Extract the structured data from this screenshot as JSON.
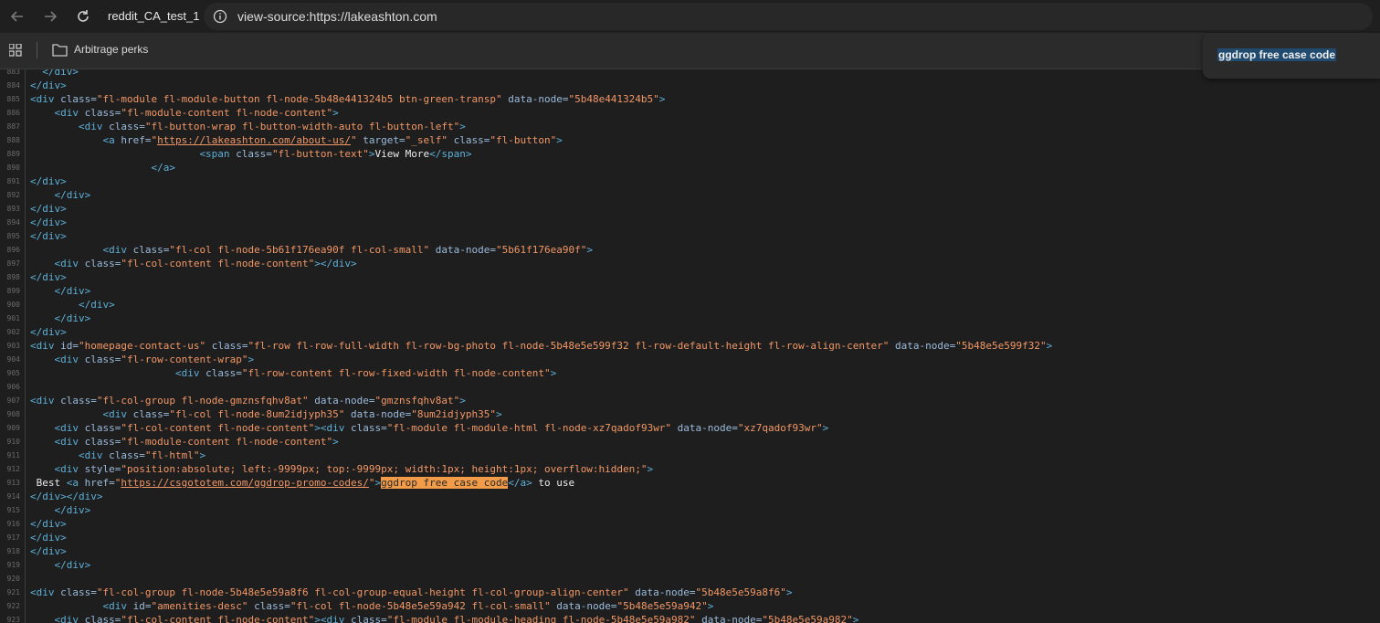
{
  "tab": {
    "title": "reddit_CA_test_1"
  },
  "omnibox": {
    "url": "view-source:https://lakeashton.com"
  },
  "bookmarks": [
    {
      "label": "Arbitrage perks"
    }
  ],
  "find": {
    "query": "ggdrop free case code"
  },
  "colors": {
    "tag": "#5db0d7",
    "attr": "#9bbbdc",
    "value": "#f29766",
    "highlight": "#f29b48",
    "background": "#1e1e1e"
  },
  "source_lines": [
    {
      "n": "883",
      "ind": 2,
      "seg": [
        [
          "tag",
          "</div>"
        ]
      ]
    },
    {
      "n": "884",
      "ind": 0,
      "seg": [
        [
          "tag",
          "</div>"
        ]
      ]
    },
    {
      "n": "885",
      "ind": 0,
      "seg": [
        [
          "tag",
          "<div "
        ],
        [
          "attr",
          "class="
        ],
        [
          "val",
          "\"fl-module fl-module-button fl-node-5b48e441324b5 btn-green-transp\""
        ],
        [
          "attr",
          " data-node="
        ],
        [
          "val",
          "\"5b48e441324b5\""
        ],
        [
          "tag",
          ">"
        ]
      ]
    },
    {
      "n": "886",
      "ind": 4,
      "seg": [
        [
          "tag",
          "<div "
        ],
        [
          "attr",
          "class="
        ],
        [
          "val",
          "\"fl-module-content fl-node-content\""
        ],
        [
          "tag",
          ">"
        ]
      ]
    },
    {
      "n": "887",
      "ind": 8,
      "seg": [
        [
          "tag",
          "<div "
        ],
        [
          "attr",
          "class="
        ],
        [
          "val",
          "\"fl-button-wrap fl-button-width-auto fl-button-left\""
        ],
        [
          "tag",
          ">"
        ]
      ]
    },
    {
      "n": "888",
      "ind": 12,
      "seg": [
        [
          "tag",
          "<a "
        ],
        [
          "attr",
          "href="
        ],
        [
          "val",
          "\""
        ],
        [
          "link",
          "https://lakeashton.com/about-us/"
        ],
        [
          "val",
          "\""
        ],
        [
          "attr",
          " target="
        ],
        [
          "val",
          "\"_self\""
        ],
        [
          "attr",
          " class="
        ],
        [
          "val",
          "\"fl-button\""
        ],
        [
          "tag",
          ">"
        ]
      ]
    },
    {
      "n": "889",
      "ind": 28,
      "seg": [
        [
          "tag",
          "<span "
        ],
        [
          "attr",
          "class="
        ],
        [
          "val",
          "\"fl-button-text\""
        ],
        [
          "tag",
          ">"
        ],
        [
          "txt",
          "View More"
        ],
        [
          "tag",
          "</span>"
        ]
      ]
    },
    {
      "n": "890",
      "ind": 20,
      "seg": [
        [
          "tag",
          "</a>"
        ]
      ]
    },
    {
      "n": "891",
      "ind": 0,
      "seg": [
        [
          "tag",
          "</div>"
        ]
      ]
    },
    {
      "n": "892",
      "ind": 4,
      "seg": [
        [
          "tag",
          "</div>"
        ]
      ]
    },
    {
      "n": "893",
      "ind": 0,
      "seg": [
        [
          "tag",
          "</div>"
        ]
      ]
    },
    {
      "n": "894",
      "ind": 0,
      "seg": [
        [
          "tag",
          "</div>"
        ]
      ]
    },
    {
      "n": "895",
      "ind": 0,
      "seg": [
        [
          "tag",
          "</div>"
        ]
      ]
    },
    {
      "n": "896",
      "ind": 12,
      "seg": [
        [
          "tag",
          "<div "
        ],
        [
          "attr",
          "class="
        ],
        [
          "val",
          "\"fl-col fl-node-5b61f176ea90f fl-col-small\""
        ],
        [
          "attr",
          " data-node="
        ],
        [
          "val",
          "\"5b61f176ea90f\""
        ],
        [
          "tag",
          ">"
        ]
      ]
    },
    {
      "n": "897",
      "ind": 4,
      "seg": [
        [
          "tag",
          "<div "
        ],
        [
          "attr",
          "class="
        ],
        [
          "val",
          "\"fl-col-content fl-node-content\""
        ],
        [
          "tag",
          "></div>"
        ]
      ]
    },
    {
      "n": "898",
      "ind": 0,
      "seg": [
        [
          "tag",
          "</div>"
        ]
      ]
    },
    {
      "n": "899",
      "ind": 4,
      "seg": [
        [
          "tag",
          "</div>"
        ]
      ]
    },
    {
      "n": "900",
      "ind": 8,
      "seg": [
        [
          "tag",
          "</div>"
        ]
      ]
    },
    {
      "n": "901",
      "ind": 4,
      "seg": [
        [
          "tag",
          "</div>"
        ]
      ]
    },
    {
      "n": "902",
      "ind": 0,
      "seg": [
        [
          "tag",
          "</div>"
        ]
      ]
    },
    {
      "n": "903",
      "ind": 0,
      "seg": [
        [
          "tag",
          "<div "
        ],
        [
          "attr",
          "id="
        ],
        [
          "val",
          "\"homepage-contact-us\""
        ],
        [
          "attr",
          " class="
        ],
        [
          "val",
          "\"fl-row fl-row-full-width fl-row-bg-photo fl-node-5b48e5e599f32 fl-row-default-height fl-row-align-center\""
        ],
        [
          "attr",
          " data-node="
        ],
        [
          "val",
          "\"5b48e5e599f32\""
        ],
        [
          "tag",
          ">"
        ]
      ]
    },
    {
      "n": "904",
      "ind": 4,
      "seg": [
        [
          "tag",
          "<div "
        ],
        [
          "attr",
          "class="
        ],
        [
          "val",
          "\"fl-row-content-wrap\""
        ],
        [
          "tag",
          ">"
        ]
      ]
    },
    {
      "n": "905",
      "ind": 24,
      "seg": [
        [
          "tag",
          "<div "
        ],
        [
          "attr",
          "class="
        ],
        [
          "val",
          "\"fl-row-content fl-row-fixed-width fl-node-content\""
        ],
        [
          "tag",
          ">"
        ]
      ]
    },
    {
      "n": "906",
      "ind": 0,
      "seg": []
    },
    {
      "n": "907",
      "ind": 0,
      "seg": [
        [
          "tag",
          "<div "
        ],
        [
          "attr",
          "class="
        ],
        [
          "val",
          "\"fl-col-group fl-node-gmznsfqhv8at\""
        ],
        [
          "attr",
          " data-node="
        ],
        [
          "val",
          "\"gmznsfqhv8at\""
        ],
        [
          "tag",
          ">"
        ]
      ]
    },
    {
      "n": "908",
      "ind": 12,
      "seg": [
        [
          "tag",
          "<div "
        ],
        [
          "attr",
          "class="
        ],
        [
          "val",
          "\"fl-col fl-node-8um2idjyph35\""
        ],
        [
          "attr",
          " data-node="
        ],
        [
          "val",
          "\"8um2idjyph35\""
        ],
        [
          "tag",
          ">"
        ]
      ]
    },
    {
      "n": "909",
      "ind": 4,
      "seg": [
        [
          "tag",
          "<div "
        ],
        [
          "attr",
          "class="
        ],
        [
          "val",
          "\"fl-col-content fl-node-content\""
        ],
        [
          "tag",
          "><div "
        ],
        [
          "attr",
          "class="
        ],
        [
          "val",
          "\"fl-module fl-module-html fl-node-xz7qadof93wr\""
        ],
        [
          "attr",
          " data-node="
        ],
        [
          "val",
          "\"xz7qadof93wr\""
        ],
        [
          "tag",
          ">"
        ]
      ]
    },
    {
      "n": "910",
      "ind": 4,
      "seg": [
        [
          "tag",
          "<div "
        ],
        [
          "attr",
          "class="
        ],
        [
          "val",
          "\"fl-module-content fl-node-content\""
        ],
        [
          "tag",
          ">"
        ]
      ]
    },
    {
      "n": "911",
      "ind": 8,
      "seg": [
        [
          "tag",
          "<div "
        ],
        [
          "attr",
          "class="
        ],
        [
          "val",
          "\"fl-html\""
        ],
        [
          "tag",
          ">"
        ]
      ]
    },
    {
      "n": "912",
      "ind": 4,
      "seg": [
        [
          "tag",
          "<div "
        ],
        [
          "attr",
          "style="
        ],
        [
          "val",
          "\"position:absolute; left:-9999px; top:-9999px; width:1px; height:1px; overflow:hidden;\""
        ],
        [
          "tag",
          ">"
        ]
      ]
    },
    {
      "n": "913",
      "ind": 0,
      "seg": [
        [
          "txt",
          " Best "
        ],
        [
          "tag",
          "<a "
        ],
        [
          "attr",
          "href="
        ],
        [
          "val",
          "\""
        ],
        [
          "link",
          "https://csgototem.com/ggdrop-promo-codes/"
        ],
        [
          "val",
          "\""
        ],
        [
          "tag",
          ">"
        ],
        [
          "hl",
          "ggdrop free case code"
        ],
        [
          "tag",
          "</a>"
        ],
        [
          "txt",
          " to use"
        ]
      ]
    },
    {
      "n": "914",
      "ind": 0,
      "seg": [
        [
          "tag",
          "</div></div>"
        ]
      ]
    },
    {
      "n": "915",
      "ind": 4,
      "seg": [
        [
          "tag",
          "</div>"
        ]
      ]
    },
    {
      "n": "916",
      "ind": 0,
      "seg": [
        [
          "tag",
          "</div>"
        ]
      ]
    },
    {
      "n": "917",
      "ind": 0,
      "seg": [
        [
          "tag",
          "</div>"
        ]
      ]
    },
    {
      "n": "918",
      "ind": 0,
      "seg": [
        [
          "tag",
          "</div>"
        ]
      ]
    },
    {
      "n": "919",
      "ind": 4,
      "seg": [
        [
          "tag",
          "</div>"
        ]
      ]
    },
    {
      "n": "920",
      "ind": 0,
      "seg": []
    },
    {
      "n": "921",
      "ind": 0,
      "seg": [
        [
          "tag",
          "<div "
        ],
        [
          "attr",
          "class="
        ],
        [
          "val",
          "\"fl-col-group fl-node-5b48e5e59a8f6 fl-col-group-equal-height fl-col-group-align-center\""
        ],
        [
          "attr",
          " data-node="
        ],
        [
          "val",
          "\"5b48e5e59a8f6\""
        ],
        [
          "tag",
          ">"
        ]
      ]
    },
    {
      "n": "922",
      "ind": 12,
      "seg": [
        [
          "tag",
          "<div "
        ],
        [
          "attr",
          "id="
        ],
        [
          "val",
          "\"amenities-desc\""
        ],
        [
          "attr",
          " class="
        ],
        [
          "val",
          "\"fl-col fl-node-5b48e5e59a942 fl-col-small\""
        ],
        [
          "attr",
          " data-node="
        ],
        [
          "val",
          "\"5b48e5e59a942\""
        ],
        [
          "tag",
          ">"
        ]
      ]
    },
    {
      "n": "923",
      "ind": 4,
      "seg": [
        [
          "tag",
          "<div "
        ],
        [
          "attr",
          "class="
        ],
        [
          "val",
          "\"fl-col-content fl-node-content\""
        ],
        [
          "tag",
          "><div "
        ],
        [
          "attr",
          "class="
        ],
        [
          "val",
          "\"fl-module fl-module-heading fl-node-5b48e5e59a982\""
        ],
        [
          "attr",
          " data-node="
        ],
        [
          "val",
          "\"5b48e5e59a982\""
        ],
        [
          "tag",
          ">"
        ]
      ]
    }
  ]
}
